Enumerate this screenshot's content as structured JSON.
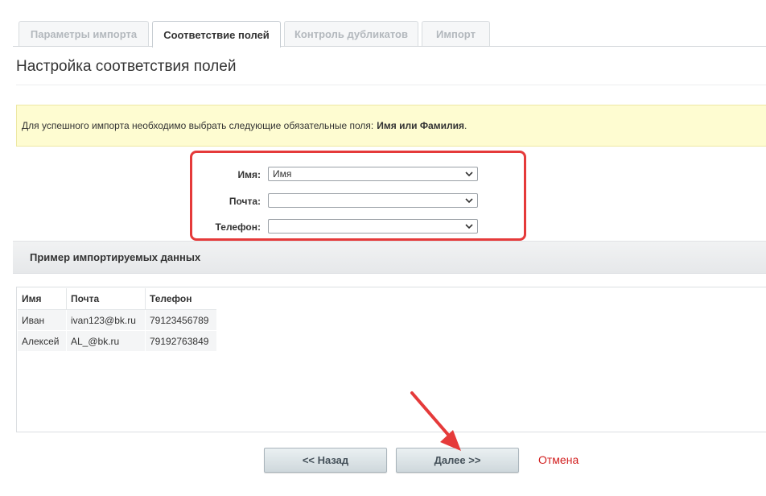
{
  "tabs": [
    {
      "label": "Параметры импорта",
      "active": false
    },
    {
      "label": "Соответствие полей",
      "active": true
    },
    {
      "label": "Контроль дубликатов",
      "active": false
    },
    {
      "label": "Импорт",
      "active": false
    }
  ],
  "page_title": "Настройка соответствия полей",
  "notice": {
    "text": "Для успешного импорта необходимо выбрать следующие обязательные поля:",
    "required": "Имя или Фамилия",
    "suffix": "."
  },
  "fields": [
    {
      "label": "Имя:",
      "value": "Имя"
    },
    {
      "label": "Почта:",
      "value": ""
    },
    {
      "label": "Телефон:",
      "value": ""
    }
  ],
  "preview": {
    "title": "Пример импортируемых данных",
    "columns": [
      "Имя",
      "Почта",
      "Телефон"
    ],
    "rows": [
      [
        "Иван",
        "ivan123@bk.ru",
        "79123456789"
      ],
      [
        "Алексей",
        "AL_@bk.ru",
        "79192763849"
      ]
    ]
  },
  "buttons": {
    "back": "<< Назад",
    "next": "Далее >>",
    "cancel": "Отмена"
  },
  "colors": {
    "highlight": "#e53a3a",
    "notice_bg": "#fefcd1",
    "cancel": "#d21f1f"
  }
}
